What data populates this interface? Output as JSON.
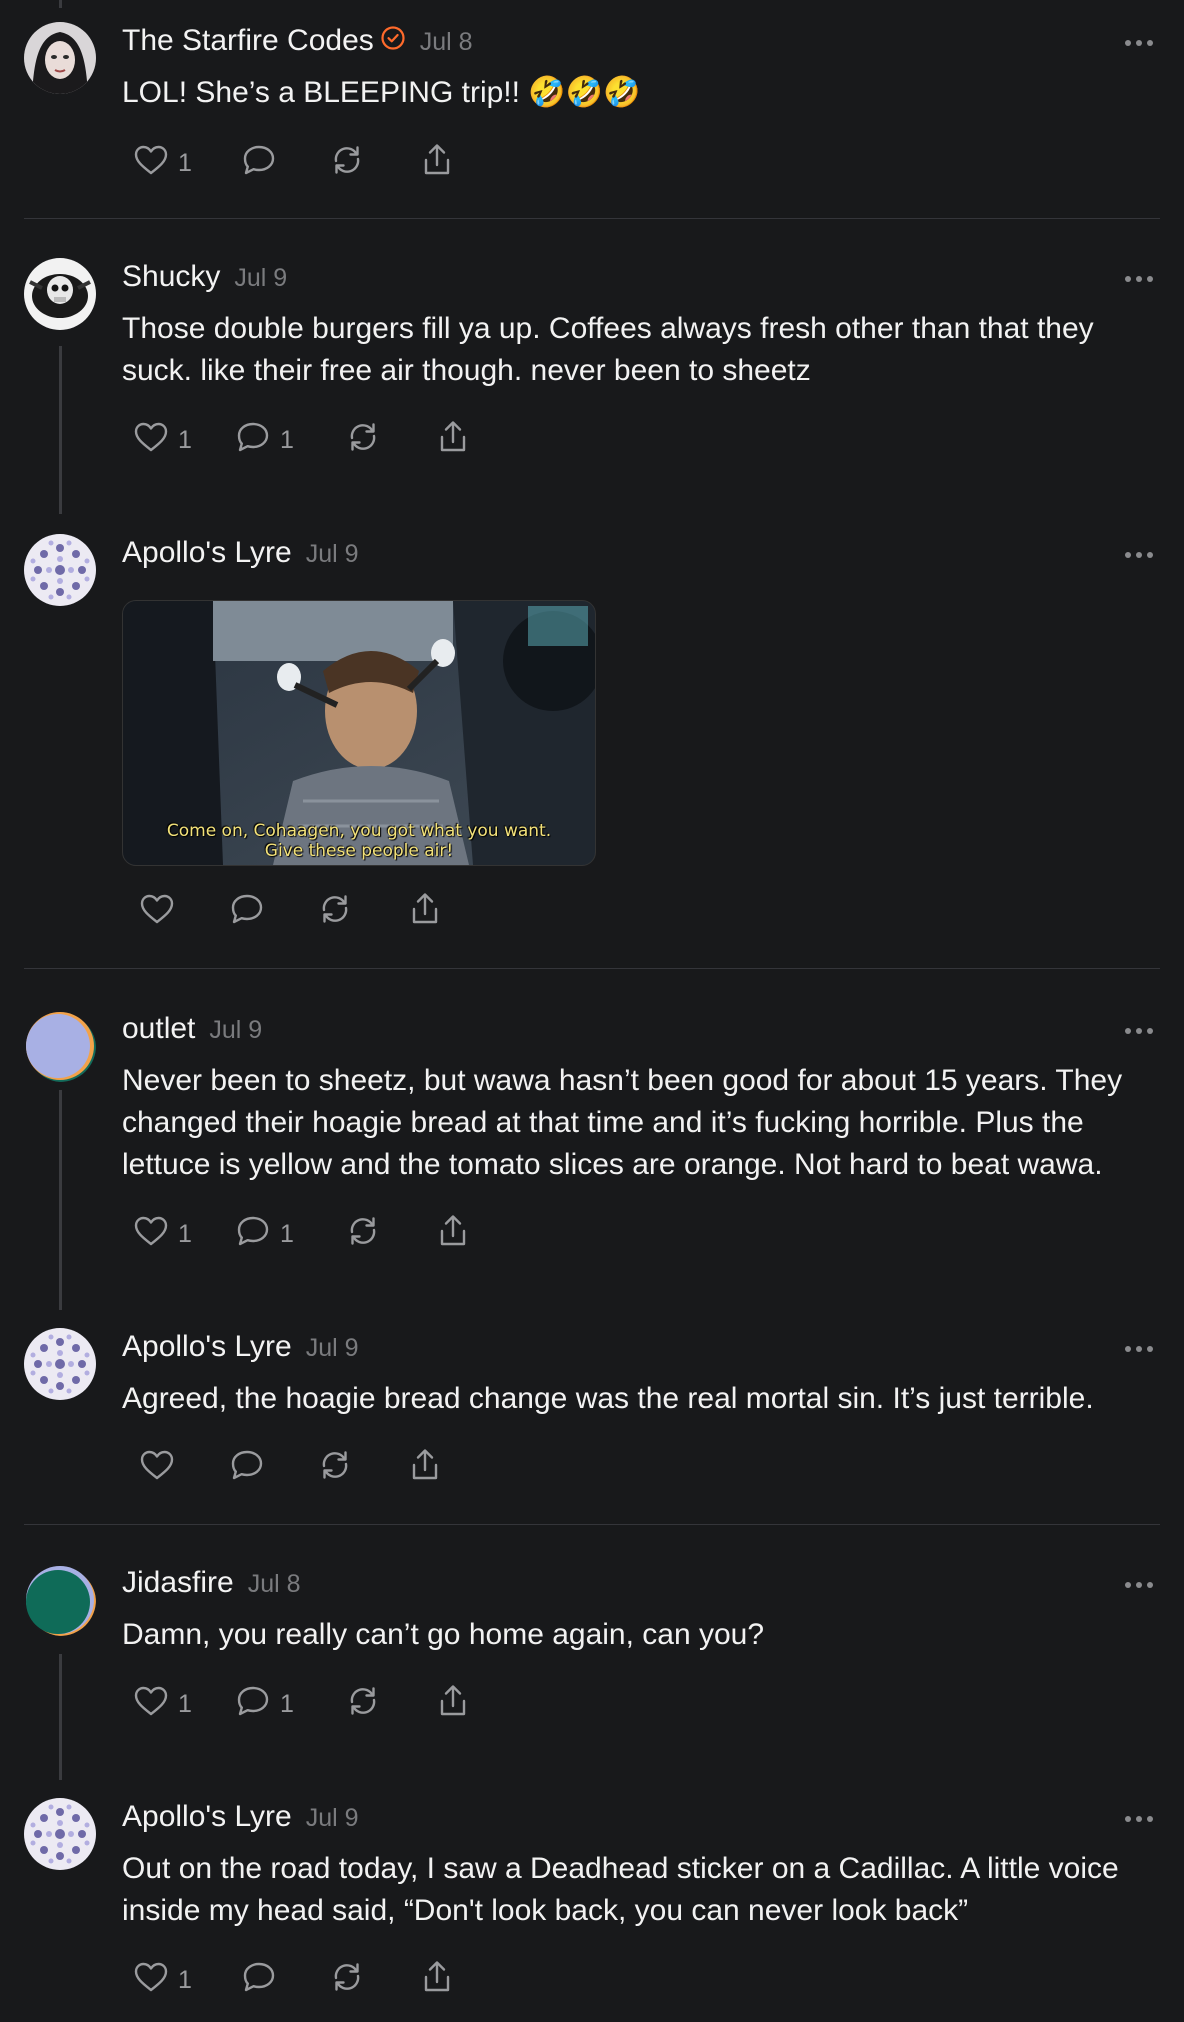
{
  "posts": [
    {
      "author": "The Starfire Codes",
      "verified": true,
      "date": "Jul 8",
      "text": "LOL! She’s a BLEEPING trip!! 🤣🤣🤣",
      "likes": "1",
      "replies": ""
    },
    {
      "author": "Shucky",
      "date": "Jul 9",
      "text": "Those double burgers fill ya up. Coffees always fresh other than that they suck. like their free air though. never been to sheetz",
      "likes": "1",
      "replies": "1"
    },
    {
      "author": "Apollo's Lyre",
      "date": "Jul 9",
      "gif_caption_line1": "Come on, Cohaagen, you got what you want.",
      "gif_caption_line2": "Give these people air!",
      "likes": "",
      "replies": ""
    },
    {
      "author": "outlet",
      "date": "Jul 9",
      "text": "Never been to sheetz, but wawa hasn’t been good for about 15 years. They changed their hoagie bread at that time and it’s fucking horrible. Plus the lettuce is yellow and the tomato slices are orange. Not hard to beat wawa.",
      "likes": "1",
      "replies": "1"
    },
    {
      "author": "Apollo's Lyre",
      "date": "Jul 9",
      "text": "Agreed, the hoagie bread change was the real mortal sin. It’s just terrible.",
      "likes": "",
      "replies": ""
    },
    {
      "author": "Jidasfire",
      "date": "Jul 8",
      "text": "Damn, you really can’t go home again, can you?",
      "likes": "1",
      "replies": "1"
    },
    {
      "author": "Apollo's Lyre",
      "date": "Jul 9",
      "text": "Out on the road today, I saw a Deadhead sticker on a Cadillac. A little voice inside my head said, “Don't look back, you can never look back”",
      "likes": "1",
      "replies": ""
    }
  ],
  "icons": {
    "like": "heart-icon",
    "reply": "comment-icon",
    "repost": "repost-icon",
    "share": "share-icon",
    "more": "more-options-icon",
    "verified": "verified-badge-icon"
  },
  "colors": {
    "background": "#18191b",
    "text": "#f2f2f2",
    "muted": "#7a7b7e",
    "verified": "#ff6a2b"
  }
}
